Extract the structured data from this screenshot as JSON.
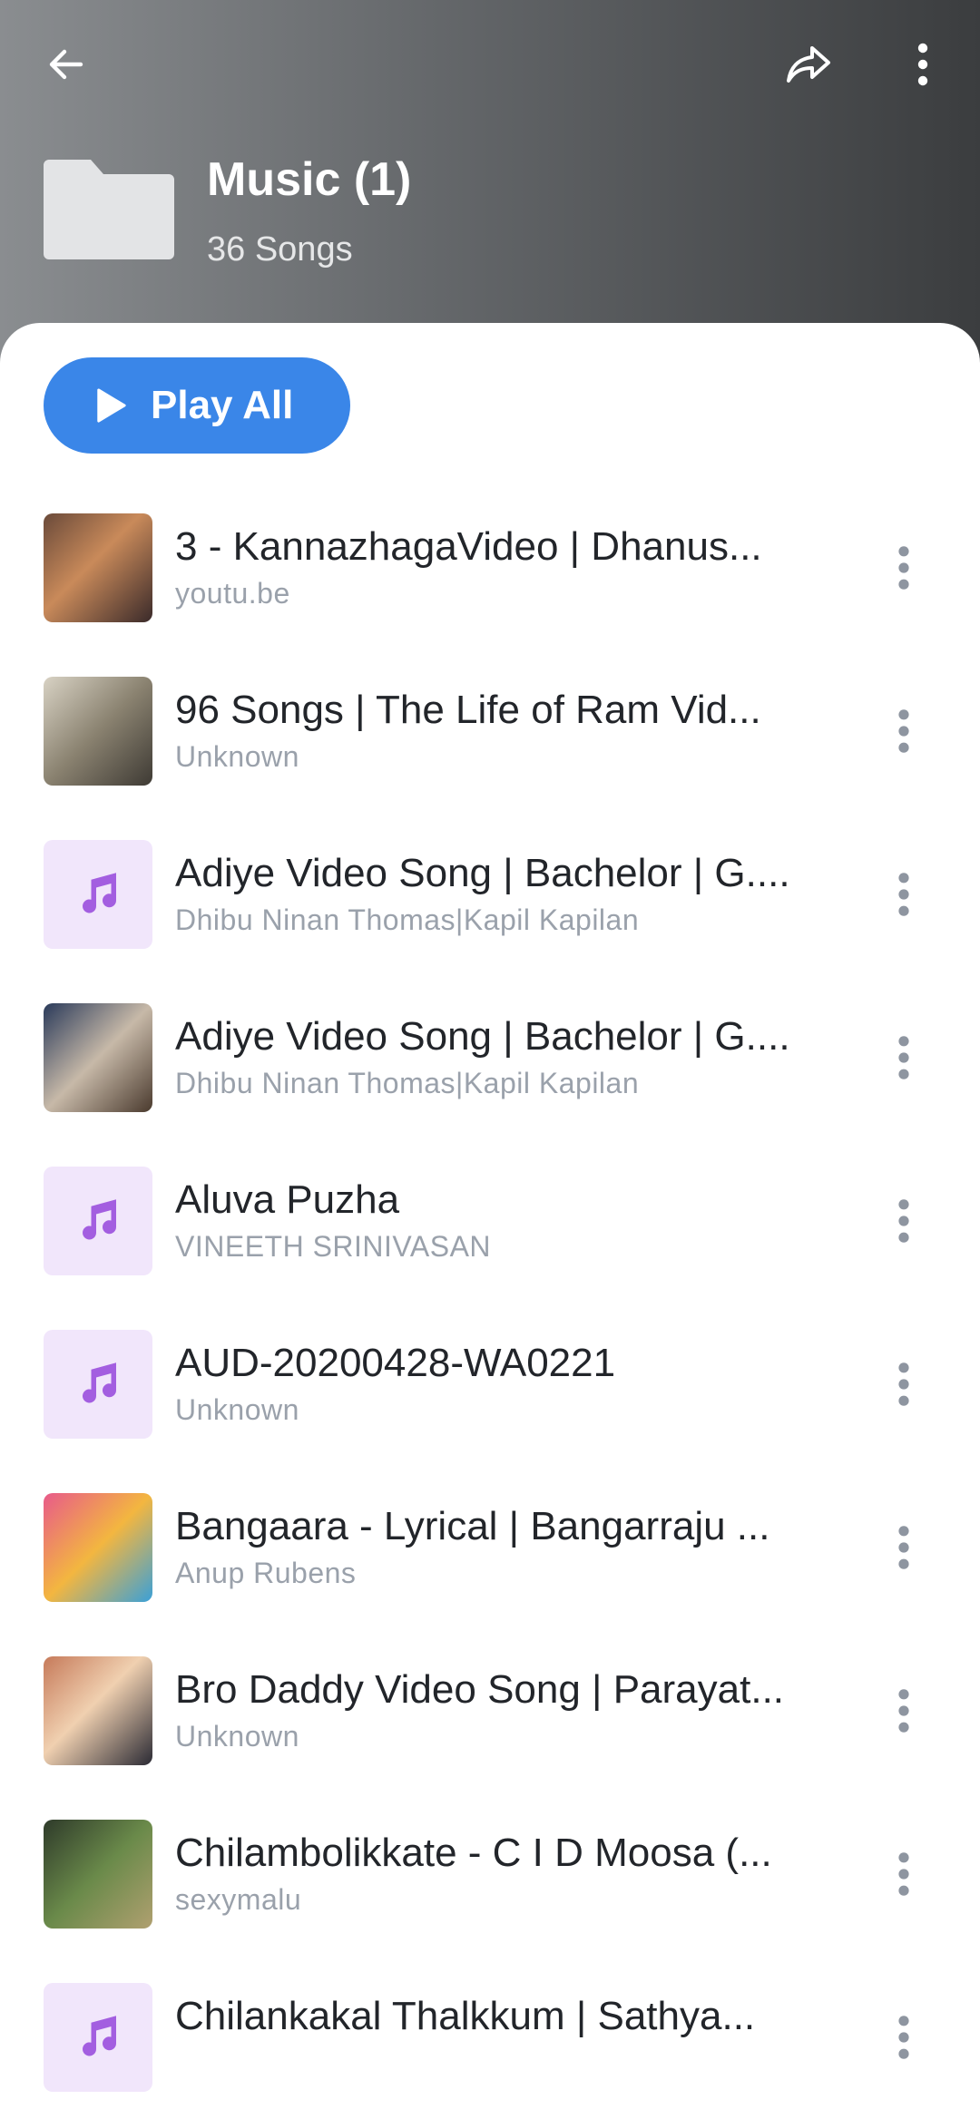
{
  "header": {
    "title": "Music (1)",
    "subtitle": "36 Songs",
    "icons": {
      "back": "arrow-left-icon",
      "share": "share-icon",
      "more": "more-vertical-icon",
      "folder": "folder-icon"
    }
  },
  "play_all": {
    "label": "Play All",
    "icon": "play-icon",
    "color": "#3a86e8"
  },
  "songs": [
    {
      "title": "3 - KannazhagaVideo | Dhanus...",
      "artist": "youtu.be",
      "thumb": "photo"
    },
    {
      "title": "96 Songs | The Life of Ram Vid...",
      "artist": "Unknown",
      "thumb": "photo"
    },
    {
      "title": "Adiye Video Song | Bachelor | G....",
      "artist": "Dhibu Ninan Thomas|Kapil Kapilan",
      "thumb": "note"
    },
    {
      "title": "Adiye Video Song | Bachelor | G....",
      "artist": "Dhibu Ninan Thomas|Kapil Kapilan",
      "thumb": "photo"
    },
    {
      "title": "Aluva Puzha",
      "artist": "VINEETH SRINIVASAN",
      "thumb": "note"
    },
    {
      "title": "AUD-20200428-WA0221",
      "artist": "Unknown",
      "thumb": "note"
    },
    {
      "title": "Bangaara - Lyrical | Bangarraju ...",
      "artist": "Anup Rubens",
      "thumb": "photo"
    },
    {
      "title": "Bro Daddy Video Song | Parayat...",
      "artist": "Unknown",
      "thumb": "photo"
    },
    {
      "title": "Chilambolikkate - C I D Moosa (...",
      "artist": "sexymalu",
      "thumb": "photo"
    },
    {
      "title": "Chilankakal Thalkkum | Sathya...",
      "artist": "",
      "thumb": "note"
    }
  ],
  "colors": {
    "accent": "#3a86e8",
    "note_tile": "#f1e6fb",
    "note_icon": "#a35ee0",
    "title_text": "#22252a",
    "artist_text": "#9aa1ab"
  }
}
